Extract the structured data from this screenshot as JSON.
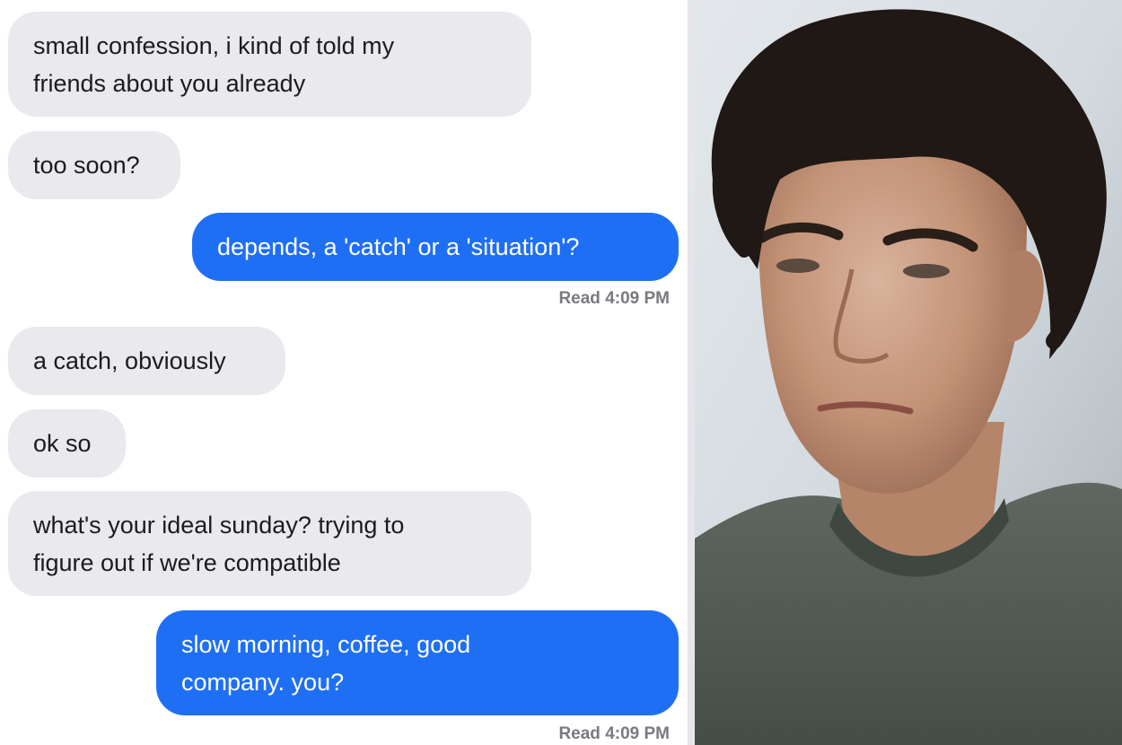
{
  "chat": {
    "messages": [
      {
        "direction": "incoming",
        "lines": [
          "small confession, i kind of told my",
          "friends about you already"
        ]
      },
      {
        "direction": "incoming",
        "lines": [
          "too soon?"
        ]
      },
      {
        "direction": "outgoing",
        "lines": [
          "depends, a 'catch' or a 'situation'?"
        ],
        "receipt": "Read 4:09 PM"
      },
      {
        "direction": "incoming",
        "lines": [
          "a catch, obviously"
        ]
      },
      {
        "direction": "incoming",
        "lines": [
          "ok so"
        ]
      },
      {
        "direction": "incoming",
        "lines": [
          "what's your ideal sunday? trying to",
          "figure out if we're compatible"
        ]
      },
      {
        "direction": "outgoing",
        "lines": [
          "slow morning, coffee, good",
          "company. you?"
        ],
        "receipt": "Read 4:09 PM"
      }
    ]
  },
  "colors": {
    "incoming_bubble": "#e9e9ee",
    "outgoing_bubble": "#1f6ff5",
    "receipt_text": "#7a7a80"
  },
  "photo": {
    "subject": "man-with-wavy-dark-hair-in-green-tshirt"
  }
}
